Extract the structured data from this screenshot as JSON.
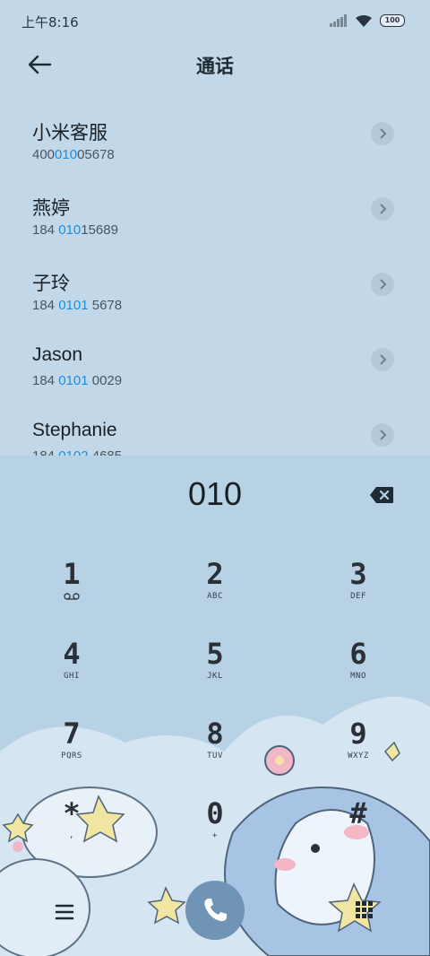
{
  "status_bar": {
    "time": "上午8:16",
    "battery": "100"
  },
  "header": {
    "title": "通话"
  },
  "contacts": [
    {
      "name": "小米客服",
      "number_prefix": "400",
      "number_match": "010",
      "number_suffix": "05678"
    },
    {
      "name": "燕婷",
      "number_prefix": "184 ",
      "number_match": "010",
      "number_suffix": "15689"
    },
    {
      "name": "子玲",
      "number_prefix": "184 ",
      "number_match": "0101",
      "number_suffix": " 5678"
    },
    {
      "name": "Jason",
      "number_prefix": "184 ",
      "number_match": "0101",
      "number_suffix": " 0029"
    },
    {
      "name": "Stephanie",
      "number_prefix": "184 ",
      "number_match": "0102",
      "number_suffix": " 4685"
    }
  ],
  "dialer": {
    "dialed": "010",
    "keys": [
      {
        "digit": "1",
        "letters": ""
      },
      {
        "digit": "2",
        "letters": "ABC"
      },
      {
        "digit": "3",
        "letters": "DEF"
      },
      {
        "digit": "4",
        "letters": "GHI"
      },
      {
        "digit": "5",
        "letters": "JKL"
      },
      {
        "digit": "6",
        "letters": "MNO"
      },
      {
        "digit": "7",
        "letters": "PQRS"
      },
      {
        "digit": "8",
        "letters": "TUV"
      },
      {
        "digit": "9",
        "letters": "WXYZ"
      },
      {
        "digit": "*",
        "letters": ","
      },
      {
        "digit": "0",
        "letters": "+"
      },
      {
        "digit": "#",
        "letters": ""
      }
    ]
  },
  "colors": {
    "background": "#c2d8e8",
    "dialpad": "#b7d1e5",
    "highlight": "#1a8fe0",
    "call_button": "#6f94b5"
  },
  "icons": {
    "back": "arrow-left-icon",
    "backspace": "backspace-icon",
    "call": "phone-icon",
    "menu": "menu-icon",
    "keypad": "keypad-icon",
    "detail": "chevron-right-icon"
  }
}
